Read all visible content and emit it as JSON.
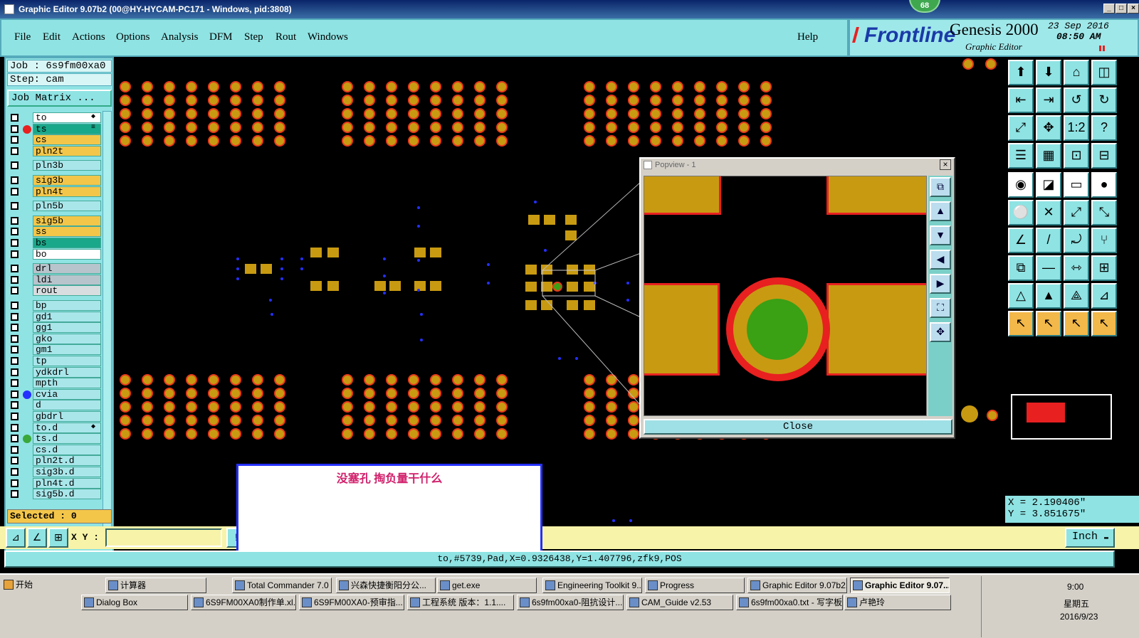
{
  "window": {
    "title": "Graphic Editor 9.07b2 (00@HY-HYCAM-PC171 - Windows, pid:3808)",
    "badge": "68"
  },
  "menu": {
    "items": [
      "File",
      "Edit",
      "Actions",
      "Options",
      "Analysis",
      "DFM",
      "Step",
      "Rout",
      "Windows"
    ],
    "help": "Help"
  },
  "logo": {
    "brand": "Frontline",
    "product": "Genesis 2000",
    "subtitle": "Graphic Editor",
    "date": "23 Sep 2016",
    "time": "08:50 AM"
  },
  "job": {
    "job_label": "Job : 6s9fm00xa0",
    "step_label": "Step: cam",
    "matrix_button": "Job Matrix ..."
  },
  "layers": [
    {
      "name": "to",
      "color": "#ffffff",
      "dot": "",
      "mark": "◆"
    },
    {
      "name": "ts",
      "color": "#1aa88a",
      "dot": "#e82020",
      "mark": "≡"
    },
    {
      "name": "cs",
      "color": "#f3c64a",
      "dot": "",
      "mark": ""
    },
    {
      "name": "pln2t",
      "color": "#f3c64a",
      "dot": "",
      "mark": ""
    },
    {
      "name": "pln3b",
      "color": "#a8e6ea",
      "dot": "",
      "mark": ""
    },
    {
      "name": "sig3b",
      "color": "#f3c64a",
      "dot": "",
      "mark": ""
    },
    {
      "name": "pln4t",
      "color": "#f3c64a",
      "dot": "",
      "mark": ""
    },
    {
      "name": "pln5b",
      "color": "#a8e6ea",
      "dot": "",
      "mark": ""
    },
    {
      "name": "sig5b",
      "color": "#f3c64a",
      "dot": "",
      "mark": ""
    },
    {
      "name": "ss",
      "color": "#f3c64a",
      "dot": "",
      "mark": ""
    },
    {
      "name": "bs",
      "color": "#1aa88a",
      "dot": "",
      "mark": ""
    },
    {
      "name": "bo",
      "color": "#ffffff",
      "dot": "",
      "mark": ""
    },
    {
      "name": "drl",
      "color": "#b8c4cc",
      "dot": "",
      "mark": ""
    },
    {
      "name": "ldi",
      "color": "#b8c4cc",
      "dot": "",
      "mark": ""
    },
    {
      "name": "rout",
      "color": "#d8dde0",
      "dot": "",
      "mark": ""
    },
    {
      "name": "bp",
      "color": "#a8e6ea",
      "dot": "",
      "mark": ""
    },
    {
      "name": "gd1",
      "color": "#a8e6ea",
      "dot": "",
      "mark": ""
    },
    {
      "name": "gg1",
      "color": "#a8e6ea",
      "dot": "",
      "mark": ""
    },
    {
      "name": "gko",
      "color": "#a8e6ea",
      "dot": "",
      "mark": ""
    },
    {
      "name": "gm1",
      "color": "#a8e6ea",
      "dot": "",
      "mark": ""
    },
    {
      "name": "tp",
      "color": "#a8e6ea",
      "dot": "",
      "mark": ""
    },
    {
      "name": "ydkdrl",
      "color": "#a8e6ea",
      "dot": "",
      "mark": ""
    },
    {
      "name": "mpth",
      "color": "#a8e6ea",
      "dot": "",
      "mark": ""
    },
    {
      "name": "cvia",
      "color": "#a8e6ea",
      "dot": "#2530ff",
      "mark": ""
    },
    {
      "name": "d",
      "color": "#a8e6ea",
      "dot": "",
      "mark": ""
    },
    {
      "name": "gbdrl",
      "color": "#a8e6ea",
      "dot": "",
      "mark": ""
    },
    {
      "name": "to.d",
      "color": "#a8e6ea",
      "dot": "",
      "mark": "◆"
    },
    {
      "name": "ts.d",
      "color": "#a8e6ea",
      "dot": "#3aa83a",
      "mark": ""
    },
    {
      "name": "cs.d",
      "color": "#a8e6ea",
      "dot": "",
      "mark": ""
    },
    {
      "name": "pln2t.d",
      "color": "#a8e6ea",
      "dot": "",
      "mark": ""
    },
    {
      "name": "sig3b.d",
      "color": "#a8e6ea",
      "dot": "",
      "mark": ""
    },
    {
      "name": "pln4t.d",
      "color": "#a8e6ea",
      "dot": "",
      "mark": ""
    },
    {
      "name": "sig5b.d",
      "color": "#a8e6ea",
      "dot": "",
      "mark": ""
    }
  ],
  "selected_label": "Selected : 0",
  "popview": {
    "title": "Popview - 1",
    "close_label": "Close"
  },
  "coords": {
    "x": "X =  2.190406\"",
    "y": "Y =  3.851675\""
  },
  "xy_label": "X Y :",
  "units": "Inch",
  "status": "to,#5739,Pad,X=0.9326438,Y=1.407796,zfk9,POS",
  "annotation": "没塞孔  掏负量干什么",
  "taskbar": {
    "start": "开始",
    "row1": [
      "计算器",
      "Total Commander 7.0 ...",
      "兴森快捷衡阳分公...",
      "get.exe",
      "Engineering Toolkit 9....",
      "Progress",
      "Graphic Editor 9.07b2...",
      "Graphic Editor 9.07..."
    ],
    "row2": [
      "Dialog Box",
      "6S9FM00XA0制作单.xl...",
      "6S9FM00XA0-预审指...",
      "工程系统  版本：1.1....",
      "6s9fm00xa0-阻抗设计...",
      "CAM_Guide v2.53",
      "6s9fm00xa0.txt - 写字板",
      "卢艳玲"
    ],
    "clock": "9:00",
    "weekday": "星期五",
    "date": "2016/9/23"
  },
  "colors": {
    "pad_fill": "#c89a12",
    "pad_outline": "#e83a1a",
    "via": "#2530ff",
    "panel": "#8fe3e3",
    "pop_green": "#3aa014"
  }
}
